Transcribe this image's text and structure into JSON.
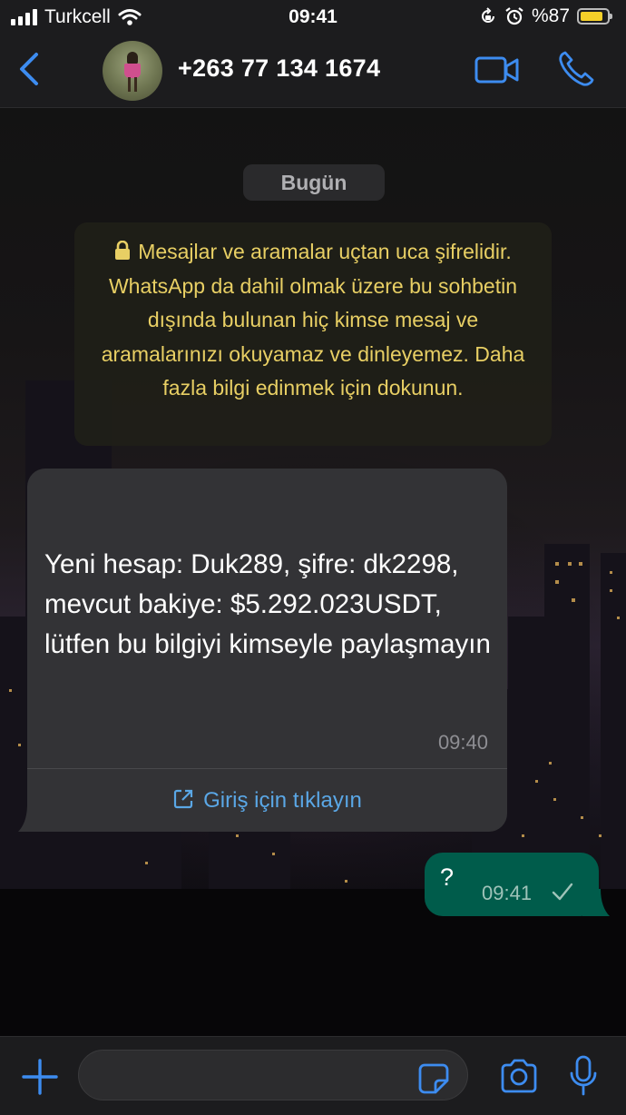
{
  "status_bar": {
    "carrier": "Turkcell",
    "time": "09:41",
    "battery_label": "%87",
    "battery_level": 0.87,
    "icons": [
      "signal-icon",
      "wifi-icon",
      "rotation-lock-icon",
      "alarm-icon",
      "battery-icon"
    ]
  },
  "header": {
    "contact": "+263 77 134 1674",
    "icons": [
      "back-chevron-icon",
      "avatar",
      "video-call-icon",
      "phone-icon"
    ]
  },
  "chat": {
    "date_label": "Bugün",
    "encryption_notice": "Mesajlar ve aramalar uçtan uca şifrelidir. WhatsApp da dahil olmak üzere bu sohbetin dışında bulunan hiç kimse mesaj ve aramalarınızı okuyamaz ve dinleyemez. Daha fazla bilgi edinmek için dokunun.",
    "incoming": {
      "text": "Yeni hesap: Duk289, şifre: dk2298, mevcut bakiye: $5.292.023USDT, lütfen bu bilgiyi kimseyle paylaşmayın",
      "time": "09:40",
      "link_label": "Giriş için tıklayın",
      "link_icon": "external-link-icon"
    },
    "outgoing": {
      "text": "?",
      "time": "09:41",
      "status_icon": "single-check-icon"
    }
  },
  "input_bar": {
    "field_value": "",
    "icons": [
      "plus-icon",
      "sticker-icon",
      "camera-icon",
      "microphone-icon"
    ]
  },
  "colors": {
    "accent": "#3d8cf0",
    "encryption_text": "#e8cf64",
    "incoming_bubble": "#333336",
    "outgoing_bubble": "#005c4b",
    "link": "#5aa7e6",
    "battery": "#f5d029"
  }
}
